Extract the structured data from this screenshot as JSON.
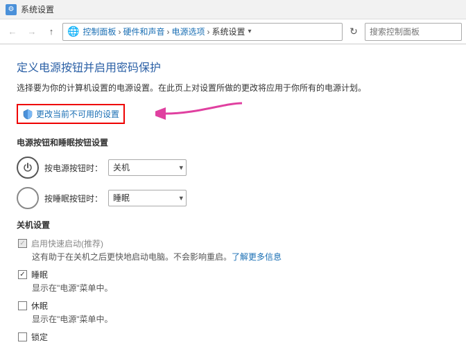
{
  "titleBar": {
    "title": "系统设置",
    "icon": "⚙"
  },
  "addressBar": {
    "back": "←",
    "forward": "→",
    "up": "↑",
    "breadcrumbs": [
      {
        "label": "控制面板",
        "active": true
      },
      {
        "label": "硬件和声音",
        "active": true
      },
      {
        "label": "电源选项",
        "active": true
      },
      {
        "label": "系统设置",
        "active": false
      }
    ],
    "refresh": "↻",
    "searchPlaceholder": "搜索控制面板"
  },
  "page": {
    "title": "定义电源按钮并启用密码保护",
    "description": "选择要为你的计算机设置的电源设置。在此页上对设置所做的更改将应用于你所有的电源计划。",
    "changeSettingsLabel": "更改当前不可用的设置",
    "powerSleepSection": "电源按钮和睡眠按钮设置",
    "powerButtonLabel": "按电源按钮时：",
    "powerButtonOption": "关机",
    "sleepButtonLabel": "按睡眠按钮时：",
    "sleepButtonOption": "睡眠",
    "shutdownSection": "关机设置",
    "options": [
      {
        "id": "fast-startup",
        "label": "启用快速启动(推荐)",
        "description": "这有助于在关机之后更快地启动电脑。不会影响重启。",
        "linkText": "了解更多信息",
        "checked": "disabled",
        "grayed": true
      },
      {
        "id": "sleep",
        "label": "睡眠",
        "description": "显示在\"电源\"菜单中。",
        "linkText": null,
        "checked": true,
        "grayed": false
      },
      {
        "id": "hibernate",
        "label": "休眠",
        "description": "显示在\"电源\"菜单中。",
        "linkText": null,
        "checked": false,
        "grayed": false
      },
      {
        "id": "lock",
        "label": "锁定",
        "description": null,
        "linkText": null,
        "checked": false,
        "grayed": false
      }
    ]
  },
  "colors": {
    "accent": "#2a5fa5",
    "link": "#1a6fb4",
    "redBorder": "#e00000",
    "arrowPink": "#e040a0"
  }
}
